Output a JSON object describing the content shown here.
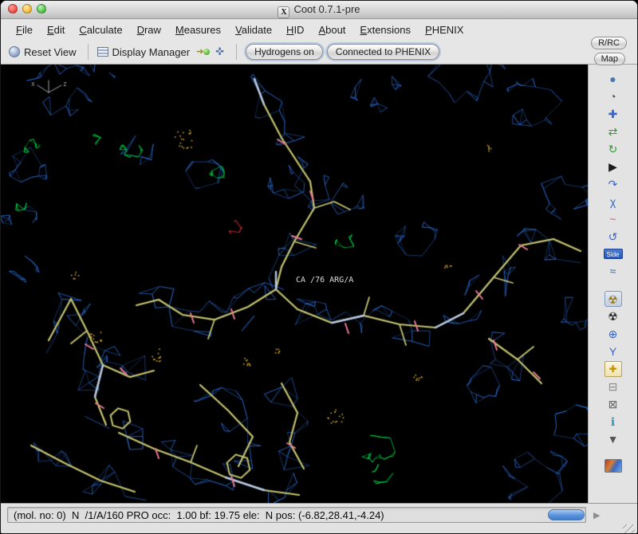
{
  "window": {
    "title": "Coot 0.7.1-pre",
    "icon_glyph": "X"
  },
  "menu": {
    "items": [
      {
        "label": "File"
      },
      {
        "label": "Edit"
      },
      {
        "label": "Calculate"
      },
      {
        "label": "Draw"
      },
      {
        "label": "Measures"
      },
      {
        "label": "Validate"
      },
      {
        "label": "HID"
      },
      {
        "label": "About"
      },
      {
        "label": "Extensions"
      },
      {
        "label": "PHENIX"
      }
    ]
  },
  "toolbar": {
    "reset_view_label": "Reset View",
    "display_manager_label": "Display Manager",
    "hydrogens_button": "Hydrogens on",
    "phenix_button": "Connected to PHENIX"
  },
  "overlay_buttons": {
    "rrc": "R/RC",
    "map": "Map"
  },
  "right_toolbar": {
    "icons": [
      {
        "name": "sphere-display-icon",
        "glyph": "●",
        "color": "#4878b0"
      },
      {
        "name": "clock-idle-icon",
        "glyph": "◔",
        "color": "#555555"
      },
      {
        "name": "fixed-atoms-icon",
        "glyph": "✚",
        "color": "#3366cc"
      },
      {
        "name": "rigid-body-fit-icon",
        "glyph": "⇄",
        "color": "#2f9e2f"
      },
      {
        "name": "rotate-translate-icon",
        "glyph": "↻",
        "color": "#2f9e2f"
      },
      {
        "name": "auto-fit-rotamer-icon",
        "glyph": "▶",
        "color": "#1a1a1a"
      },
      {
        "name": "rotamers-icon",
        "glyph": "↷",
        "color": "#3366cc"
      },
      {
        "name": "edit-chi-angles-icon",
        "glyph": "χ",
        "color": "#3366cc"
      },
      {
        "name": "torsion-general-icon",
        "glyph": "~",
        "color": "#cc6688"
      },
      {
        "name": "flip-peptide-icon",
        "glyph": "↺",
        "color": "#3366cc"
      },
      {
        "name": "side-chain-180-button",
        "badge": "Side",
        "color": "#2a55b0"
      },
      {
        "name": "edit-backbone-icon",
        "glyph": "≈",
        "color": "#3366cc"
      },
      {
        "name": "sphere-refine-button",
        "glyph": "☢",
        "color": "#9a7400",
        "pressed": true,
        "gap_before": true
      },
      {
        "name": "refine-zone-icon",
        "glyph": "☢",
        "color": "#222222"
      },
      {
        "name": "add-terminal-residue-icon",
        "glyph": "⊕",
        "color": "#3366cc"
      },
      {
        "name": "add-alt-conf-icon",
        "glyph": "Y",
        "color": "#3366cc"
      },
      {
        "name": "place-atom-icon",
        "glyph": "✚",
        "color": "#c89000",
        "boxed": true
      },
      {
        "name": "eraser-icon",
        "glyph": "⊟",
        "color": "#888888"
      },
      {
        "name": "delete-item-icon",
        "glyph": "⊠",
        "color": "#666666"
      },
      {
        "name": "residue-info-icon",
        "glyph": "ℹ",
        "color": "#2299bb"
      },
      {
        "name": "down-arrow-icon",
        "glyph": "▼",
        "color": "#555555"
      },
      {
        "name": "ligand-picture-icon",
        "picture": true,
        "gap_before": true
      }
    ]
  },
  "viewport": {
    "atom_label": "CA /76 ARG/A",
    "axis_x": "x",
    "axis_z": "z"
  },
  "statusbar": {
    "text": "(mol. no: 0)  N  /1/A/160 PRO occ:  1.00 bf: 19.75 ele:  N pos: (-6.82,28.41,-4.24)",
    "overflow_arrow": "▶"
  },
  "colors": {
    "map_blue": "#2b6fd8",
    "density_green": "#00c040",
    "density_red": "#cc2a2a",
    "model_yellow": "#c2c270",
    "model_light": "#b6c6e4",
    "oxygen_pink": "#e87890",
    "dots_yellow": "#c8a030",
    "axes_gray": "#99a4aa"
  }
}
